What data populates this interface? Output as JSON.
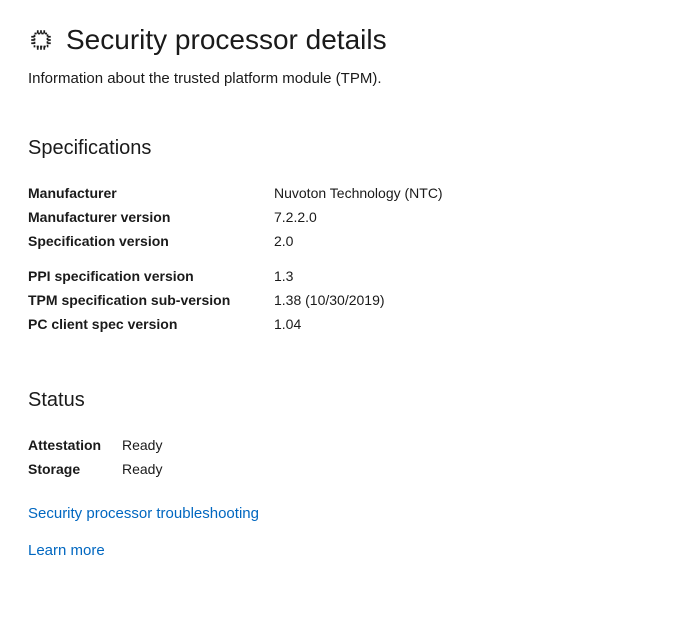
{
  "header": {
    "title": "Security processor details",
    "subtitle": "Information about the trusted platform module (TPM)."
  },
  "specifications": {
    "heading": "Specifications",
    "group1": [
      {
        "label": "Manufacturer",
        "value": "Nuvoton Technology (NTC)"
      },
      {
        "label": "Manufacturer version",
        "value": "7.2.2.0"
      },
      {
        "label": "Specification version",
        "value": "2.0"
      }
    ],
    "group2": [
      {
        "label": "PPI specification version",
        "value": "1.3"
      },
      {
        "label": "TPM specification sub-version",
        "value": "1.38 (10/30/2019)"
      },
      {
        "label": "PC client spec version",
        "value": "1.04"
      }
    ]
  },
  "status": {
    "heading": "Status",
    "rows": [
      {
        "label": "Attestation",
        "value": "Ready"
      },
      {
        "label": "Storage",
        "value": "Ready"
      }
    ]
  },
  "links": {
    "troubleshooting": "Security processor troubleshooting",
    "learn_more": "Learn more"
  }
}
